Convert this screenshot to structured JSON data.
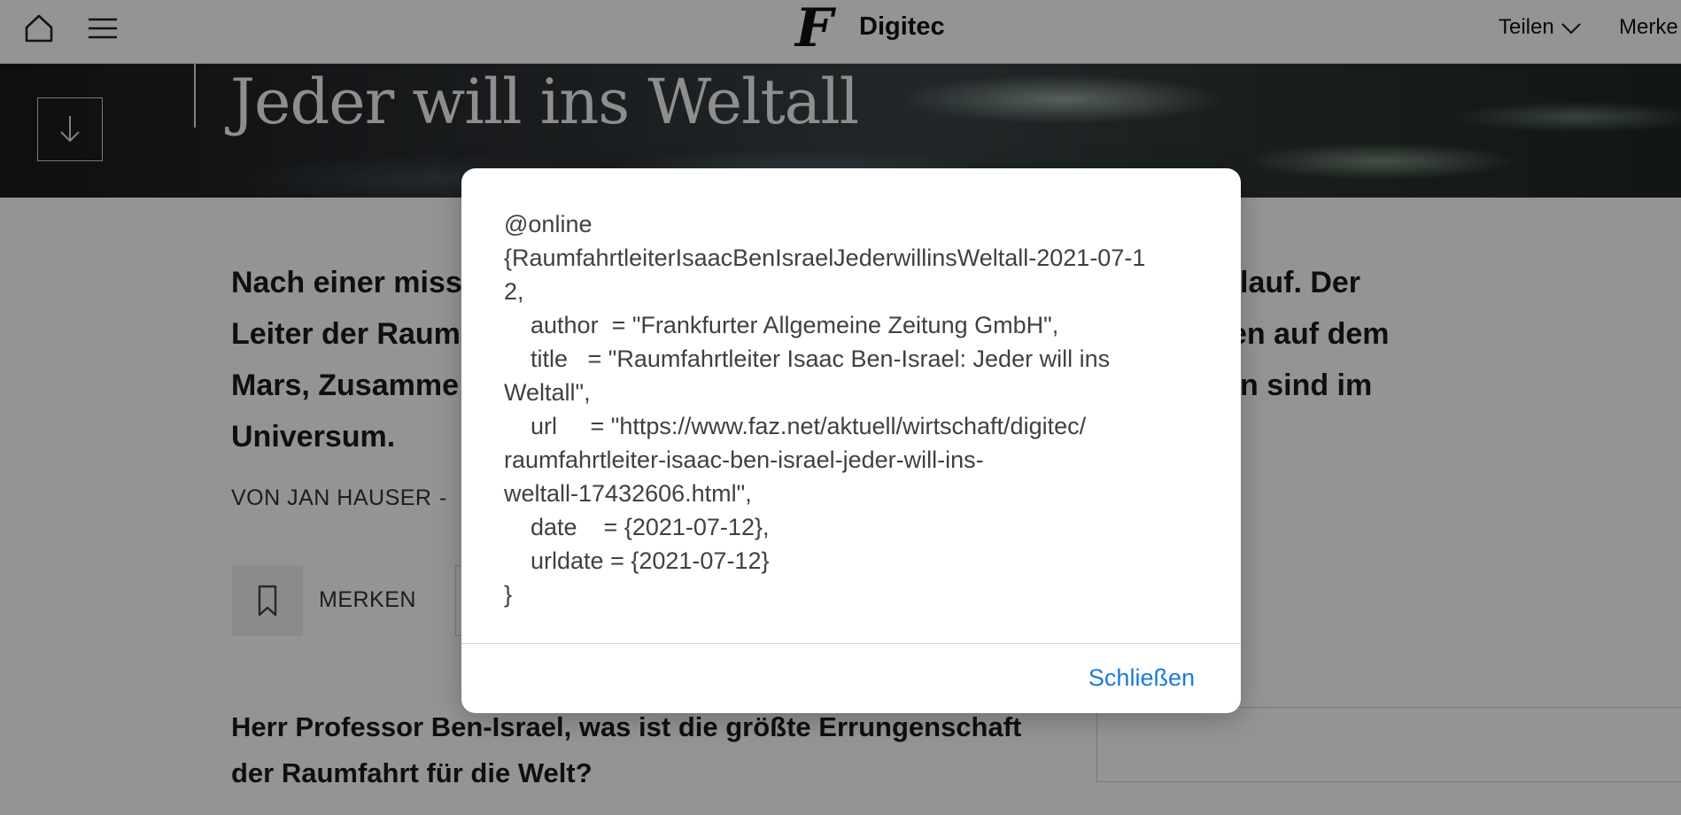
{
  "topbar": {
    "brand_letter": "F",
    "brand_name": "Digitec",
    "share_label": "Teilen",
    "bookmark_label": "Merke"
  },
  "hero": {
    "title": "Jeder will ins Weltall"
  },
  "article": {
    "lead_lines": [
      "Nach einer miss",
      "Leiter der Raum",
      "Mars, Zusamme",
      "Universum."
    ],
    "lead_right_lines": [
      "lauf. Der",
      "en auf dem",
      "n sind im"
    ],
    "byline": "VON JAN HAUSER",
    "byline_separator": "-",
    "bookmark_button_label": "MERKEN",
    "question_lines": [
      "Herr Professor Ben-Israel, was ist die größte Errungenschaft",
      "der Raumfahrt für die Welt?"
    ]
  },
  "dialog": {
    "lines": [
      "@online",
      "{RaumfahrtleiterIsaacBenIsraelJederwillinsWeltall-2021-07-1",
      "2,",
      "    author  = \"Frankfurter Allgemeine Zeitung GmbH\",",
      "    title   = \"Raumfahrtleiter Isaac Ben-Israel: Jeder will ins",
      "Weltall\",",
      "    url     = \"https://www.faz.net/aktuell/wirtschaft/digitec/",
      "raumfahrtleiter-isaac-ben-israel-jeder-will-ins-",
      "weltall-17432606.html\",",
      "    date    = {2021-07-12},",
      "    urldate = {2021-07-12}",
      "}"
    ],
    "close_label": "Schließen"
  },
  "colors": {
    "link_blue": "#1a7bd8",
    "overlay": "rgba(0,0,0,0.42)"
  }
}
